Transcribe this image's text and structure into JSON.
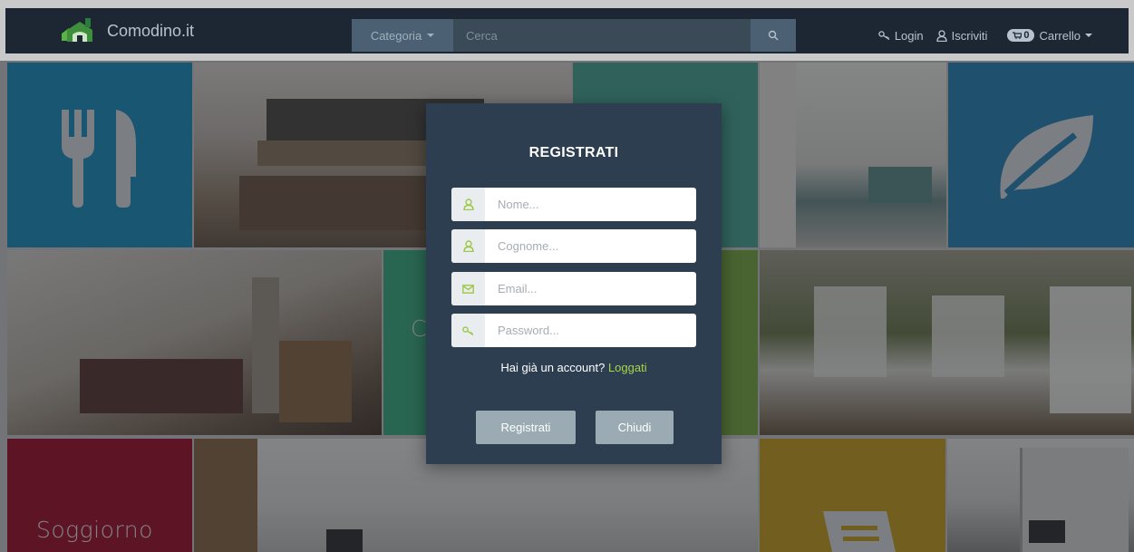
{
  "colors": {
    "navbar": "#1d2733",
    "modal": "#2c3e50",
    "accent_green": "#a7d44a",
    "tile_blue": "#1e91bf",
    "tile_teal": "#4aa894",
    "tile_green_light": "#3dae82",
    "tile_olive": "#7aab44",
    "tile_crimson": "#a0152f",
    "tile_gold": "#c8a021",
    "tile_leaf_blue": "#2a84b7"
  },
  "navbar": {
    "brand": "Comodino.it",
    "category_label": "Categoria",
    "search_placeholder": "Cerca",
    "login": "Login",
    "signup": "Iscriviti",
    "cart_count": "0",
    "cart_label": "Carrello",
    "icons": [
      "house-logo-icon",
      "search-icon",
      "key-icon",
      "user-icon",
      "cart-icon"
    ]
  },
  "tiles": {
    "living_label": "Soggiorno",
    "partial_label": "C",
    "icons": [
      "cutlery-icon",
      "leaf-icon",
      "book-icon"
    ]
  },
  "modal": {
    "title": "REGISTRATI",
    "fields": [
      {
        "placeholder": "Nome...",
        "icon": "user-icon"
      },
      {
        "placeholder": "Cognome...",
        "icon": "user-icon"
      },
      {
        "placeholder": "Email...",
        "icon": "envelope-icon"
      },
      {
        "placeholder": "Password...",
        "icon": "key-icon"
      }
    ],
    "account_question": "Hai già un account?",
    "login_link": "Loggati",
    "submit_label": "Registrati",
    "close_label": "Chiudi"
  }
}
